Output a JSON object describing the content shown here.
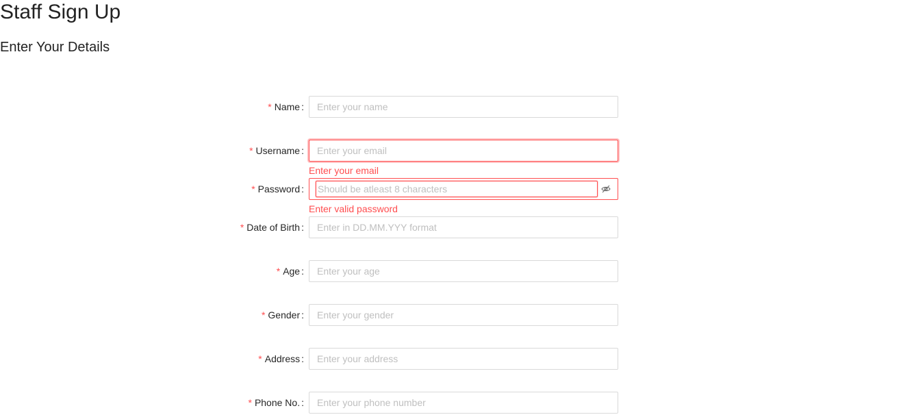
{
  "header": {
    "title": "Staff Sign Up",
    "subtitle": "Enter Your Details"
  },
  "form": {
    "colon": ":",
    "required_mark": "*",
    "name": {
      "label": "Name",
      "placeholder": "Enter your name"
    },
    "username": {
      "label": "Username",
      "placeholder": "Enter your email",
      "error": "Enter your email"
    },
    "password": {
      "label": "Password",
      "placeholder": "Should be atleast 8 characters",
      "error": "Enter valid password",
      "toggle_icon": "eye-invisible-icon"
    },
    "dob": {
      "label": "Date of Birth",
      "placeholder": "Enter in DD.MM.YYY format"
    },
    "age": {
      "label": "Age",
      "placeholder": "Enter your age"
    },
    "gender": {
      "label": "Gender",
      "placeholder": "Enter your gender"
    },
    "address": {
      "label": "Address",
      "placeholder": "Enter your address"
    },
    "phone": {
      "label": "Phone No.",
      "placeholder": "Enter your phone number"
    }
  },
  "colors": {
    "error": "#ff4d4f",
    "border": "#d9d9d9",
    "placeholder": "#bfbfbf"
  }
}
